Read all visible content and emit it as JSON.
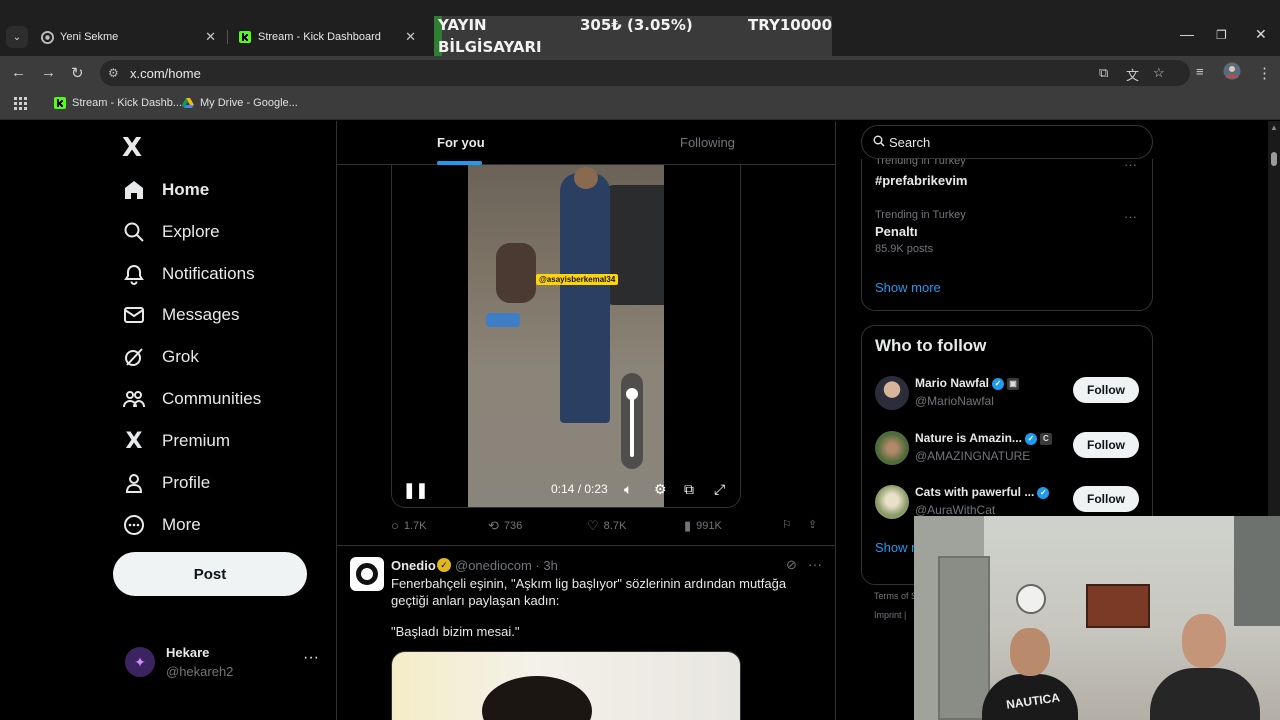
{
  "browser": {
    "tabs": [
      {
        "title": "Yeni Sekme",
        "icon": "chrome-icon"
      },
      {
        "title": "Stream - Kick Dashboard",
        "icon": "kick-icon"
      }
    ],
    "ticker": {
      "label_line1": "YAYIN",
      "label_line2": "BİLGİSAYARI",
      "change": "305₺ (3.05%)",
      "amount": "TRY10000",
      "accent": "#2e7d32"
    },
    "url": "x.com/home",
    "bookmarks": [
      {
        "label": "Stream - Kick Dashb...",
        "icon": "kick-icon"
      },
      {
        "label": "My Drive - Google...",
        "icon": "drive-icon"
      }
    ]
  },
  "sidebar": {
    "logo": "X",
    "items": [
      {
        "label": "Home",
        "icon": "home-icon"
      },
      {
        "label": "Explore",
        "icon": "search-icon"
      },
      {
        "label": "Notifications",
        "icon": "bell-icon"
      },
      {
        "label": "Messages",
        "icon": "envelope-icon"
      },
      {
        "label": "Grok",
        "icon": "grok-icon"
      },
      {
        "label": "Communities",
        "icon": "people-icon"
      },
      {
        "label": "Premium",
        "icon": "x-icon"
      },
      {
        "label": "Profile",
        "icon": "person-icon"
      },
      {
        "label": "More",
        "icon": "more-circle-icon"
      }
    ],
    "post_label": "Post",
    "account": {
      "name": "Hekare",
      "handle": "@hekareh2"
    }
  },
  "feed": {
    "tabs": [
      "For you",
      "Following"
    ],
    "video": {
      "overlay_tag": "@asayisberkemal34",
      "time": "0:14 / 0:23",
      "volume": 0.9,
      "stats": {
        "replies": "1.7K",
        "reposts": "736",
        "likes": "8.7K",
        "views": "991K"
      }
    },
    "tweet2": {
      "name": "Onedio",
      "meta": "@onediocom · 3h",
      "text": "Fenerbahçeli eşinin, \"Aşkım lig başlıyor\" sözlerinin ardından mutfağa geçtiği anları paylaşan kadın:",
      "quote": "\"Başladı bizim mesai.\""
    }
  },
  "right": {
    "search_placeholder": "Search",
    "trends": {
      "partial_category": "Trending in Turkey",
      "partial_name": "#prefabrikevim",
      "item": {
        "category": "Trending in Turkey",
        "name": "Penaltı",
        "posts": "85.9K posts"
      },
      "show_more": "Show more"
    },
    "who_to_follow": {
      "title": "Who to follow",
      "users": [
        {
          "name": "Mario Nawfal",
          "handle": "@MarioNawfal",
          "badge": "▣"
        },
        {
          "name": "Nature is Amazin...",
          "handle": "@AMAZINGNATURE",
          "badge": "C"
        },
        {
          "name": "Cats with pawerful ...",
          "handle": "@AuraWithCat",
          "badge": ""
        }
      ],
      "follow_label": "Follow",
      "show_more": "Show m"
    },
    "footer": {
      "terms": "Terms of S",
      "imprint": "Imprint |"
    }
  },
  "webcam": {
    "shirt_text": "NAUTICA"
  },
  "colors": {
    "accent_blue": "#1d9bf0",
    "verified_gold": "#e2b719",
    "bg": "#000000"
  }
}
